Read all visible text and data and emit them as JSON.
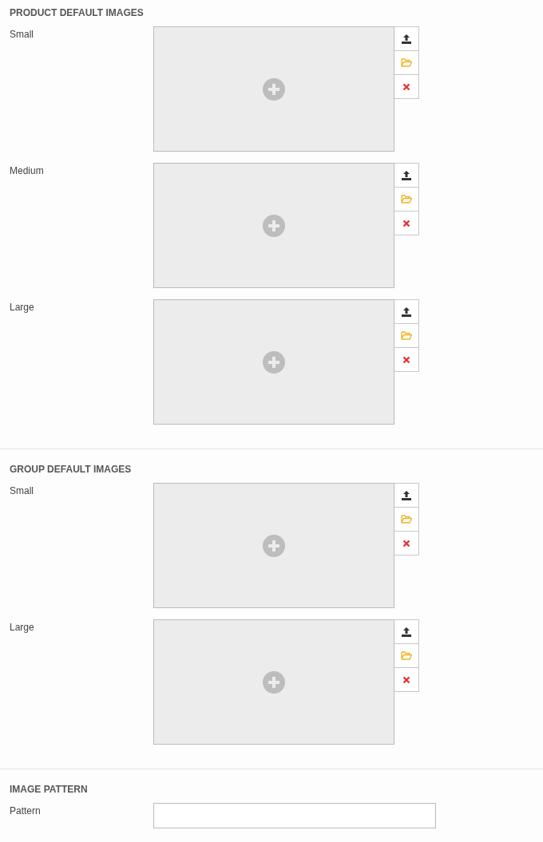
{
  "sections": [
    {
      "title": "PRODUCT DEFAULT IMAGES",
      "fields": [
        {
          "kind": "image",
          "label": "Small"
        },
        {
          "kind": "image",
          "label": "Medium"
        },
        {
          "kind": "image",
          "label": "Large"
        }
      ]
    },
    {
      "title": "GROUP DEFAULT IMAGES",
      "fields": [
        {
          "kind": "image",
          "label": "Small"
        },
        {
          "kind": "image",
          "label": "Large"
        }
      ]
    },
    {
      "title": "IMAGE PATTERN",
      "fields": [
        {
          "kind": "text",
          "label": "Pattern"
        }
      ]
    }
  ]
}
